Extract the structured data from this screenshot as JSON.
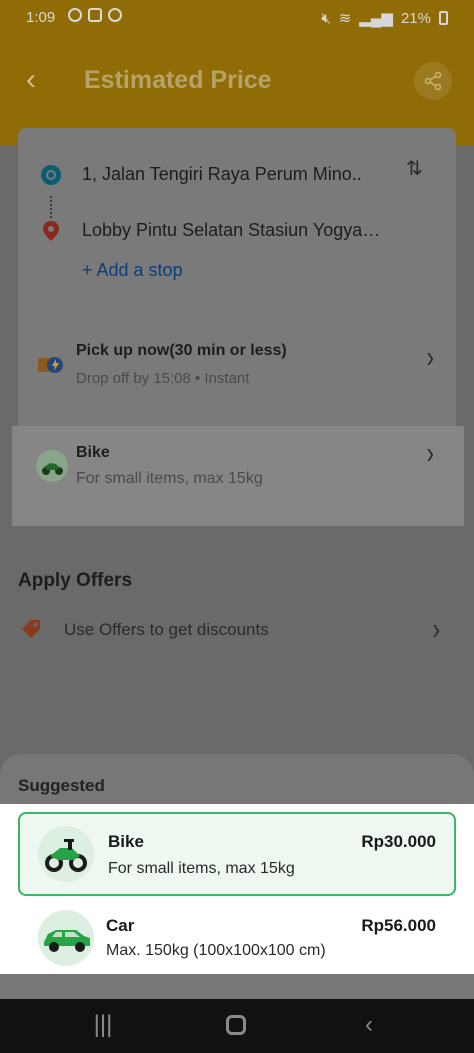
{
  "status_bar": {
    "time": "1:09",
    "battery": "21%"
  },
  "header": {
    "title": "Estimated Price"
  },
  "route": {
    "pickup": "1, Jalan Tengiri Raya Perum Mino..",
    "dropoff": "Lobby Pintu Selatan Stasiun Yogyakar..",
    "add_stop": "+ Add a stop"
  },
  "schedule": {
    "title": "Pick up now(30 min or less)",
    "subtitle": "Drop off by 15:08 • Instant"
  },
  "selected_vehicle": {
    "title": "Bike",
    "subtitle": "For small items, max 15kg"
  },
  "offers": {
    "title": "Apply Offers",
    "label": "Use Offers to get discounts"
  },
  "sheet": {
    "heading": "Suggested",
    "options": [
      {
        "name": "Bike",
        "desc": "For small items, max 15kg",
        "price": "Rp30.000",
        "icon": "motorbike-icon",
        "selected": true
      },
      {
        "name": "Car",
        "desc": "Max. 150kg (100x100x100 cm)",
        "price": "Rp56.000",
        "icon": "car-icon",
        "selected": false
      }
    ]
  },
  "colors": {
    "accent_green": "#3bb56a",
    "header_yellow": "#f2b705",
    "link_blue": "#1565c0"
  }
}
